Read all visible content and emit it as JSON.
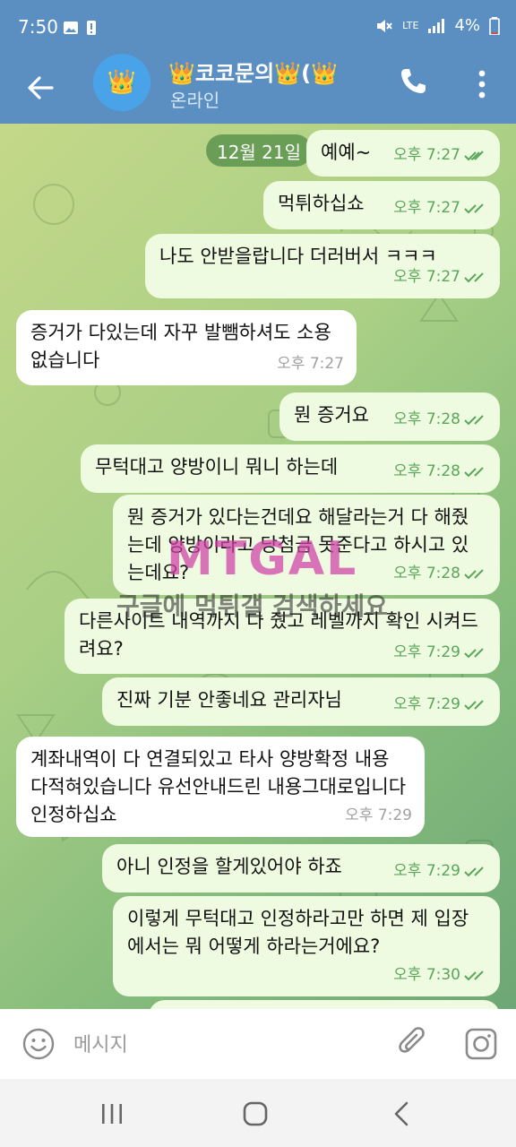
{
  "status_bar": {
    "time": "7:50",
    "network": "LTE",
    "battery": "4%"
  },
  "header": {
    "title": "👑코코문의👑(👑",
    "avatar_emoji": "👑",
    "subtitle": "온라인"
  },
  "chat": {
    "date": "12월 21일",
    "messages": [
      {
        "dir": "out",
        "text": "예예~",
        "time": "오후 7:27"
      },
      {
        "dir": "out",
        "text": "먹튀하십쇼",
        "time": "오후 7:27"
      },
      {
        "dir": "out",
        "text": "나도 안받을랍니다 더러버서 ㅋㅋㅋ",
        "time": "오후 7:27"
      },
      {
        "dir": "in",
        "text": "증거가 다있는데 자꾸 발뺌하셔도 소용없습니다",
        "time": "오후 7:27"
      },
      {
        "dir": "out",
        "text": "뭔 증거요",
        "time": "오후 7:28"
      },
      {
        "dir": "out",
        "text": "무턱대고 양방이니 뭐니 하는데",
        "time": "오후 7:28"
      },
      {
        "dir": "out",
        "text": "뭔 증거가 있다는건데요 해달라는거 다 해줬는데 양방이라고 당첨금 못준다고 하시고 있는데요?",
        "time": "오후 7:28"
      },
      {
        "dir": "out",
        "text": "다른사이트 내역까지 다 줬고 레벨까지 확인 시켜드려요?",
        "time": "오후 7:29"
      },
      {
        "dir": "out",
        "text": "진짜 기분 안좋네요 관리자님",
        "time": "오후 7:29"
      },
      {
        "dir": "in",
        "text": "계좌내역이 다 연결되있고 타사 양방확정 내용 다적혀있습니다 유선안내드린 내용그대로입니다 인정하십쇼",
        "time": "오후 7:29"
      },
      {
        "dir": "out",
        "text": "아니 인정을 할게있어야 하죠",
        "time": "오후 7:29"
      },
      {
        "dir": "out",
        "text": "이렇게 무턱대고 인정하라고만 하면 제 입장에서는 뭐 어떻게 하라는거에요?",
        "time": "오후 7:30"
      }
    ]
  },
  "watermark": {
    "logo": "MTGAL",
    "text": "구글에 먹튀갤 검색하세요"
  },
  "composer": {
    "placeholder": "메시지"
  },
  "icons": {
    "back": "arrow-left-icon",
    "call": "phone-icon",
    "more": "more-vertical-icon",
    "emoji": "emoji-icon",
    "attach": "paperclip-icon",
    "camera": "camera-icon",
    "read": "double-check-icon"
  },
  "colors": {
    "header": "#5b8fc2",
    "bubble_out": "#eefbe0",
    "bubble_in": "#ffffff",
    "check": "#5aa65b"
  }
}
